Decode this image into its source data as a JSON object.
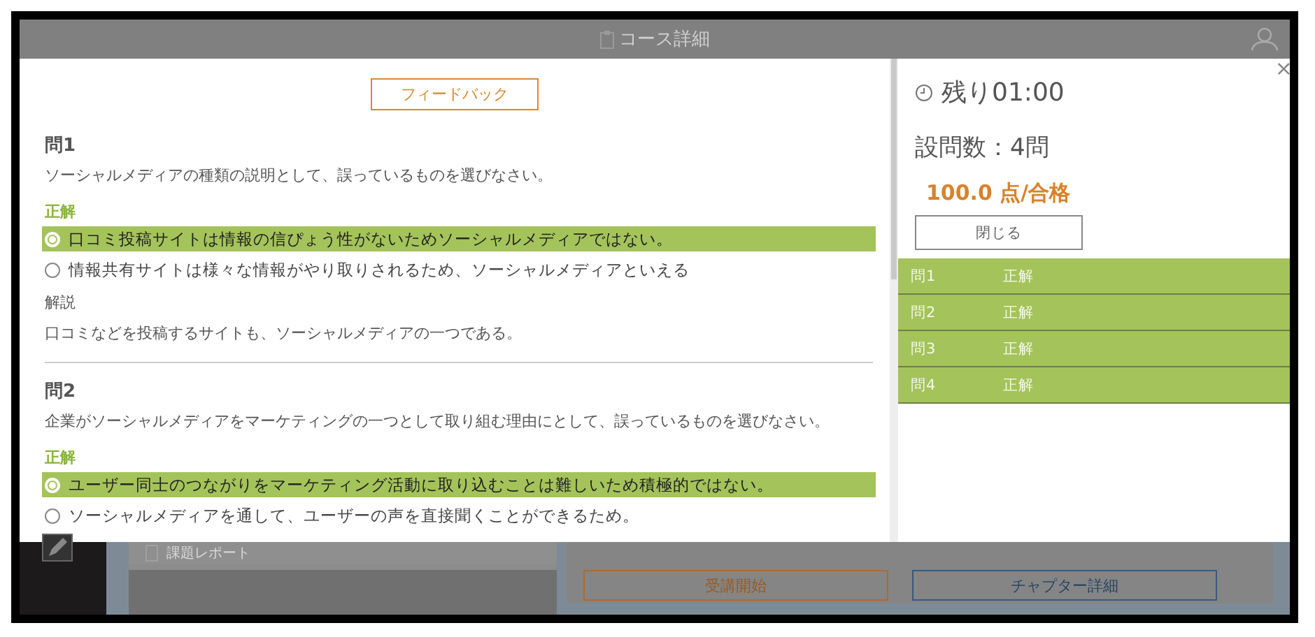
{
  "header": {
    "title": "コース詳細"
  },
  "feedback_button": "フィードバック",
  "questions": [
    {
      "number": "問1",
      "text": "ソーシャルメディアの種類の説明として、誤っているものを選びなさい。",
      "answer_label": "正解",
      "options": [
        {
          "text": "口コミ投稿サイトは情報の信ぴょう性がないためソーシャルメディアではない。",
          "selected": true
        },
        {
          "text": "情報共有サイトは様々な情報がやり取りされるため、ソーシャルメディアといえる",
          "selected": false
        }
      ],
      "explanation_label": "解説",
      "explanation": "口コミなどを投稿するサイトも、ソーシャルメディアの一つである。"
    },
    {
      "number": "問2",
      "text": "企業がソーシャルメディアをマーケティングの一つとして取り組む理由にとして、誤っているものを選びなさい。",
      "answer_label": "正解",
      "options": [
        {
          "text": "ユーザー同士のつながりをマーケティング活動に取り込むことは難しいため積極的ではない。",
          "selected": true
        },
        {
          "text": "ソーシャルメディアを通して、ユーザーの声を直接聞くことができるため。",
          "selected": false
        }
      ]
    }
  ],
  "summary": {
    "close_symbol": "×",
    "remaining": "残り01:00",
    "question_count": "設問数：4問",
    "score": "100.0 点/合格",
    "close_button": "閉じる",
    "results": [
      {
        "question": "問1",
        "result": "正解"
      },
      {
        "question": "問2",
        "result": "正解"
      },
      {
        "question": "問3",
        "result": "正解"
      },
      {
        "question": "問4",
        "result": "正解"
      }
    ]
  },
  "background": {
    "report_item": "課題レポート",
    "buttons": [
      {
        "label": "受講開始",
        "kind": "primary"
      },
      {
        "label": "チャプター詳細",
        "kind": "secondary"
      }
    ]
  }
}
